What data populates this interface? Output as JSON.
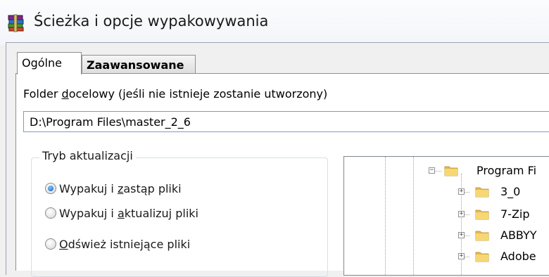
{
  "window": {
    "title": "Ścieżka i opcje wypakowywania"
  },
  "tabs": [
    {
      "label": "Ogólne",
      "active": true
    },
    {
      "label": "Zaawansowane",
      "active": false
    }
  ],
  "destination": {
    "label_before": "Folder ",
    "label_accel": "d",
    "label_after": "ocelowy (jeśli nie istnieje zostanie utworzony)",
    "path_value": "D:\\Program Files\\master_2_6"
  },
  "update_mode": {
    "title": "Tryb aktualizacji",
    "options": [
      {
        "before": "Wypakuj i ",
        "accel": "z",
        "after": "astąp pliki",
        "checked": true
      },
      {
        "before": "Wypakuj i ",
        "accel": "a",
        "after": "ktualizuj pliki",
        "checked": false
      },
      {
        "before": "",
        "accel": "O",
        "after": "dśwież istniejące pliki",
        "checked": false
      }
    ]
  },
  "folder_tree": {
    "root": {
      "label": "Program Fi",
      "expander": "−"
    },
    "children": [
      {
        "label": "3_0",
        "expander": "+"
      },
      {
        "label": "7-Zip",
        "expander": "+"
      },
      {
        "label": "ABBYY",
        "expander": "+"
      },
      {
        "label": "Adobe",
        "expander": "+"
      }
    ]
  },
  "colors": {
    "accent": "#1659b8",
    "folder": "#e8b94a",
    "border": "#8e8f8f"
  },
  "icons": {
    "app": "winrar-books-icon",
    "folder": "folder-icon"
  }
}
